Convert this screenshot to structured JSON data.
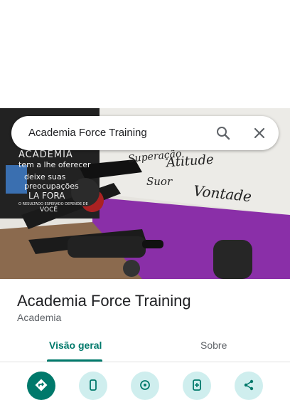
{
  "search": {
    "query": "Academia Force Training"
  },
  "photo": {
    "wall_words": [
      "Superação",
      "Atitude",
      "Suor",
      "Vontade"
    ],
    "sign_lines": [
      "ACADEMIA",
      "tem a lhe oferecer",
      "deixe suas",
      "preocupações",
      "LA FORA",
      "O RESULTADO ESPERADO DEPENDE DE",
      "VOCÊ"
    ]
  },
  "place": {
    "name": "Academia Force Training",
    "category": "Academia"
  },
  "tabs": {
    "overview": "Visão geral",
    "about": "Sobre"
  },
  "actions": [
    "directions-icon",
    "phone-icon",
    "nearby-icon",
    "save-to-phone-icon",
    "share-icon"
  ],
  "colors": {
    "accent": "#00796b",
    "action_bg": "#cfeeee",
    "wall_purple": "#8a2fa8"
  }
}
